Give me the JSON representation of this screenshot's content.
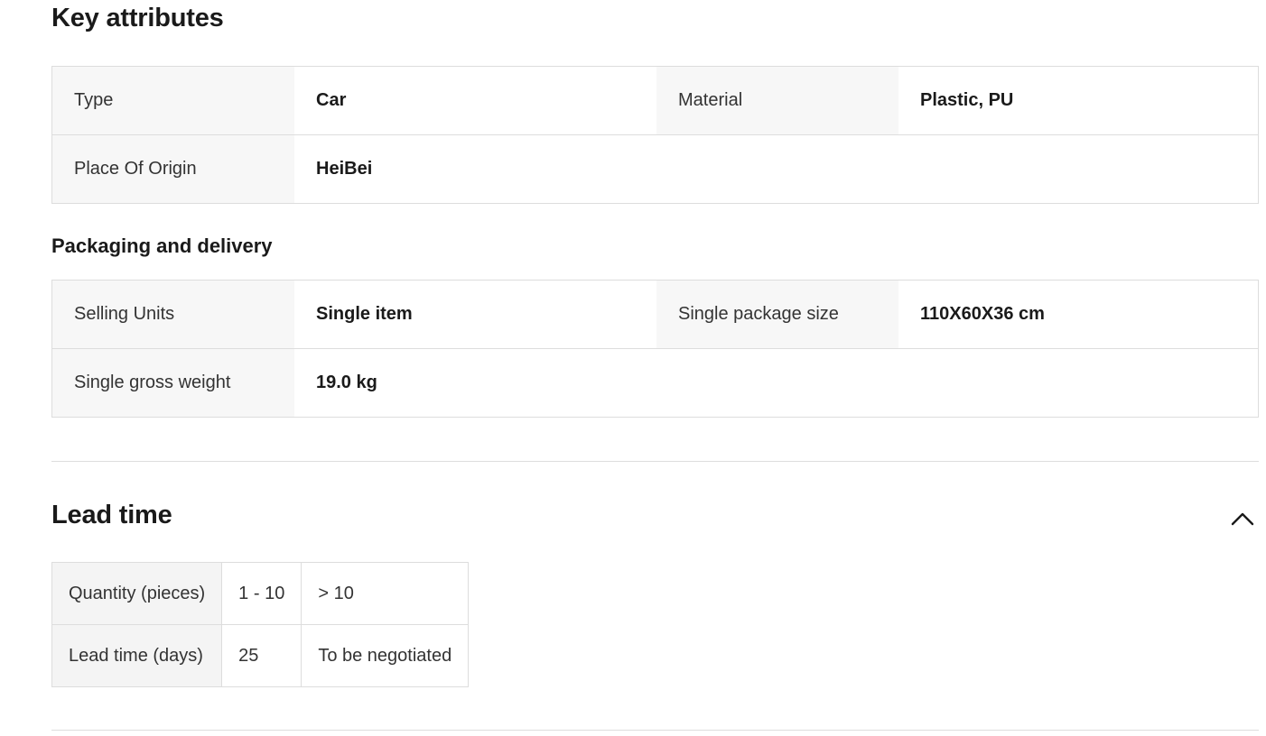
{
  "key_attributes": {
    "title": "Key attributes",
    "rows": [
      [
        {
          "label": "Type",
          "value": "Car"
        },
        {
          "label": "Material",
          "value": "Plastic, PU"
        }
      ],
      [
        {
          "label": "Place Of Origin",
          "value": "HeiBei"
        }
      ]
    ]
  },
  "packaging": {
    "title": "Packaging and delivery",
    "rows": [
      [
        {
          "label": "Selling Units",
          "value": "Single item"
        },
        {
          "label": "Single package size",
          "value": "110X60X36 cm"
        }
      ],
      [
        {
          "label": "Single gross weight",
          "value": "19.0 kg"
        }
      ]
    ]
  },
  "lead_time": {
    "title": "Lead time",
    "collapse_icon": "chevron-up-icon",
    "table": {
      "quantity_label": "Quantity (pieces)",
      "quantity_ranges": [
        "1 - 10",
        "> 10"
      ],
      "days_label": "Lead time (days)",
      "days_values": [
        "25",
        "To be negotiated"
      ]
    }
  }
}
